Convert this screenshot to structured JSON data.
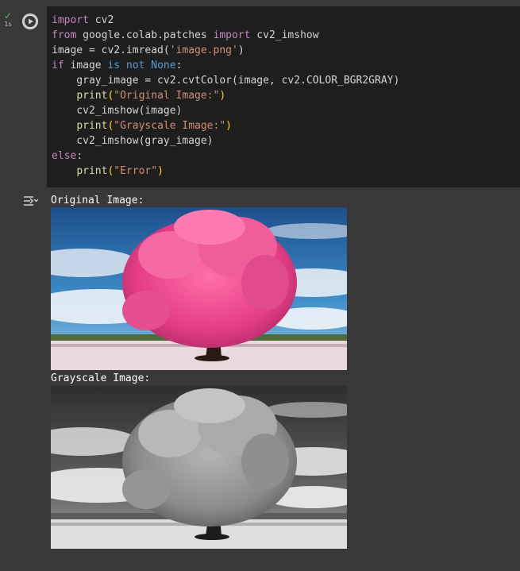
{
  "status": {
    "check_glyph": "✓",
    "exec_time": "1s",
    "icon": "check-icon",
    "color": "#5bb974"
  },
  "run_button": {
    "icon": "play-icon"
  },
  "code_lines": [
    [
      [
        "kw",
        "import"
      ],
      [
        "pl",
        " cv2"
      ]
    ],
    [
      [
        "kw",
        "from"
      ],
      [
        "pl",
        " google.colab.patches "
      ],
      [
        "kw",
        "import"
      ],
      [
        "pl",
        " cv2_imshow"
      ]
    ],
    [
      [
        "pl",
        "image = cv2.imread("
      ],
      [
        "st",
        "'image.png'"
      ],
      [
        "pl",
        ")"
      ]
    ],
    [
      [
        "kw",
        "if"
      ],
      [
        "pl",
        " image "
      ],
      [
        "bl",
        "is not"
      ],
      [
        "pl",
        " "
      ],
      [
        "bl",
        "None"
      ],
      [
        "pl",
        ":"
      ]
    ],
    [
      [
        "pl",
        "    gray_image = cv2.cvtColor(image, cv2.COLOR_BGR2GRAY)"
      ]
    ],
    [
      [
        "pl",
        "    "
      ],
      [
        "fn",
        "print"
      ],
      [
        "paren",
        "("
      ],
      [
        "st",
        "\"Original Image:\""
      ],
      [
        "paren",
        ")"
      ]
    ],
    [
      [
        "pl",
        "    cv2_imshow(image)"
      ]
    ],
    [
      [
        "pl",
        "    "
      ],
      [
        "fn",
        "print"
      ],
      [
        "paren",
        "("
      ],
      [
        "st",
        "\"Grayscale Image:\""
      ],
      [
        "paren",
        ")"
      ]
    ],
    [
      [
        "pl",
        "    cv2_imshow(gray_image)"
      ]
    ],
    [
      [
        "kw",
        "else"
      ],
      [
        "pl",
        ":"
      ]
    ],
    [
      [
        "pl",
        "    "
      ],
      [
        "fn",
        "print"
      ],
      [
        "paren",
        "("
      ],
      [
        "st",
        "\"Error\""
      ],
      [
        "paren",
        ")"
      ]
    ]
  ],
  "output": {
    "icon": "output-toggle-icon",
    "original_label": "Original Image:",
    "grayscale_label": "Grayscale Image:"
  },
  "colors": {
    "editor_bg": "#1e1e1e",
    "cell_bg": "#383838",
    "keyword": "#c586c0",
    "builtin": "#569cd6",
    "string": "#ce9178",
    "function": "#dcdcaa"
  }
}
